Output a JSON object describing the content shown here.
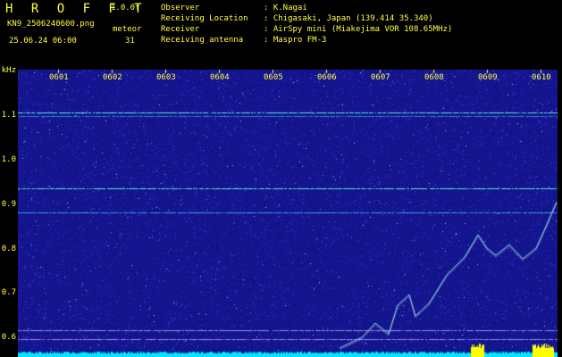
{
  "header": {
    "logo": "H R O F F T",
    "version": "1.0.0f",
    "filename": "KN9_2506240600.png",
    "datetime": "25.06.24 06:00",
    "meteor_label": "meteor",
    "meteor_count": "31",
    "observer_label": "Observer",
    "observer_value": ": K.Nagai",
    "location_label": "Receiving Location",
    "location_value": ": Chigasaki, Japan (139.414 35.340)",
    "receiver_label": "Receiver",
    "receiver_value": ": AirSpy mini (Miakejima VOR 108.65MHz)",
    "antenna_label": "Receiving antenna",
    "antenna_value": ": Maspro FM-3"
  },
  "axes": {
    "y_unit": "kHz",
    "y_ticks": [
      "1.1",
      "1.0",
      "0.9",
      "0.8",
      "0.7",
      "0.6"
    ],
    "x_ticks": [
      "0601",
      "0602",
      "0603",
      "0604",
      "0605",
      "0606",
      "0607",
      "0608",
      "0609",
      "0610"
    ]
  },
  "colors": {
    "background": "#000000",
    "text": "#ffff40",
    "noise_base": "#1a1ab0",
    "signal": "#40e0e0",
    "baseline": "#00e8ff",
    "baseline_peak": "#ffff00"
  }
}
